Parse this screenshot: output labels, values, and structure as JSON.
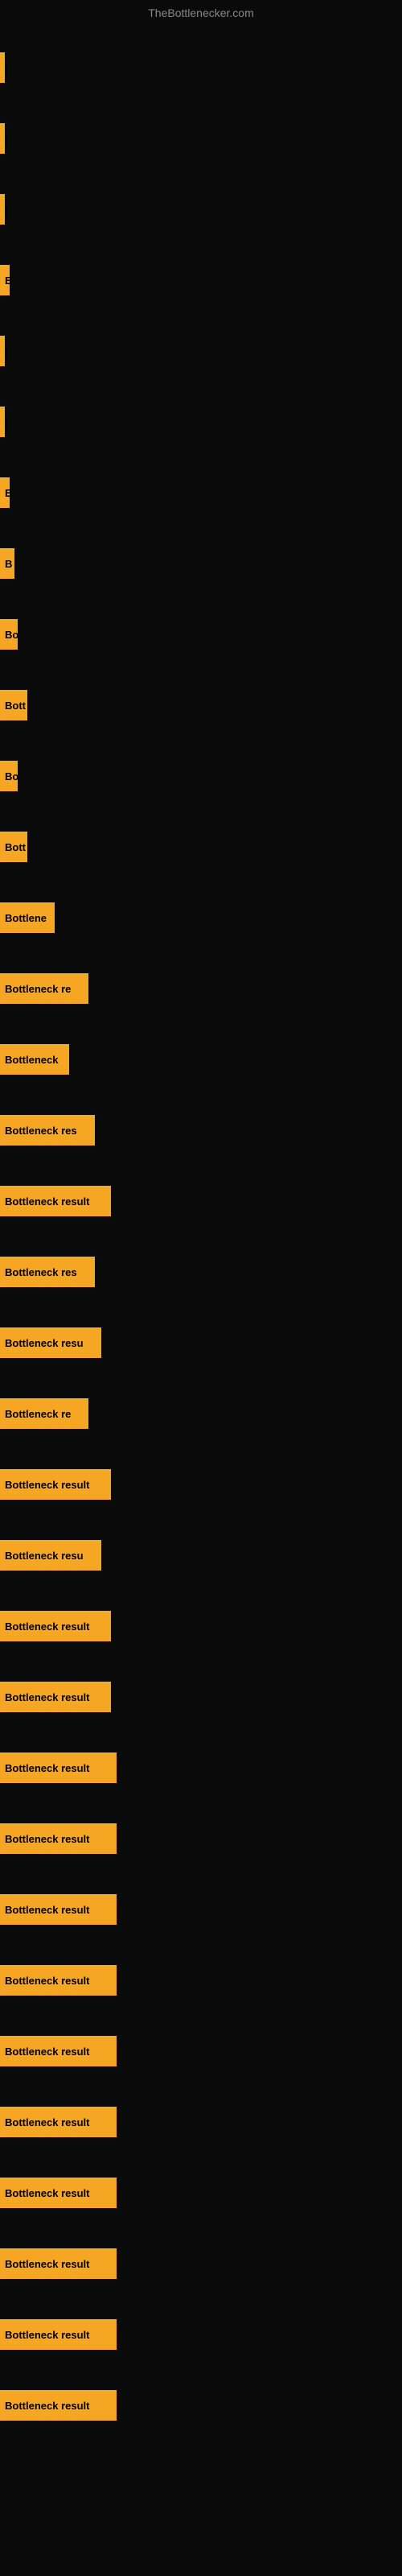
{
  "site": {
    "title": "TheBottlenecker.com"
  },
  "bars": [
    {
      "label": "|",
      "width": 4
    },
    {
      "label": "|",
      "width": 4
    },
    {
      "label": "|",
      "width": 4
    },
    {
      "label": "E",
      "width": 12
    },
    {
      "label": "|",
      "width": 4
    },
    {
      "label": "|",
      "width": 4
    },
    {
      "label": "E",
      "width": 12
    },
    {
      "label": "B",
      "width": 18
    },
    {
      "label": "Bo",
      "width": 22
    },
    {
      "label": "Bott",
      "width": 34
    },
    {
      "label": "Bo",
      "width": 22
    },
    {
      "label": "Bott",
      "width": 34
    },
    {
      "label": "Bottlene",
      "width": 68
    },
    {
      "label": "Bottleneck re",
      "width": 110
    },
    {
      "label": "Bottleneck",
      "width": 86
    },
    {
      "label": "Bottleneck res",
      "width": 118
    },
    {
      "label": "Bottleneck result",
      "width": 138
    },
    {
      "label": "Bottleneck res",
      "width": 118
    },
    {
      "label": "Bottleneck resu",
      "width": 126
    },
    {
      "label": "Bottleneck re",
      "width": 110
    },
    {
      "label": "Bottleneck result",
      "width": 138
    },
    {
      "label": "Bottleneck resu",
      "width": 126
    },
    {
      "label": "Bottleneck result",
      "width": 138
    },
    {
      "label": "Bottleneck result",
      "width": 138
    },
    {
      "label": "Bottleneck result",
      "width": 145
    },
    {
      "label": "Bottleneck result",
      "width": 145
    },
    {
      "label": "Bottleneck result",
      "width": 145
    },
    {
      "label": "Bottleneck result",
      "width": 145
    },
    {
      "label": "Bottleneck result",
      "width": 145
    },
    {
      "label": "Bottleneck result",
      "width": 145
    },
    {
      "label": "Bottleneck result",
      "width": 145
    },
    {
      "label": "Bottleneck result",
      "width": 145
    },
    {
      "label": "Bottleneck result",
      "width": 145
    },
    {
      "label": "Bottleneck result",
      "width": 145
    }
  ]
}
